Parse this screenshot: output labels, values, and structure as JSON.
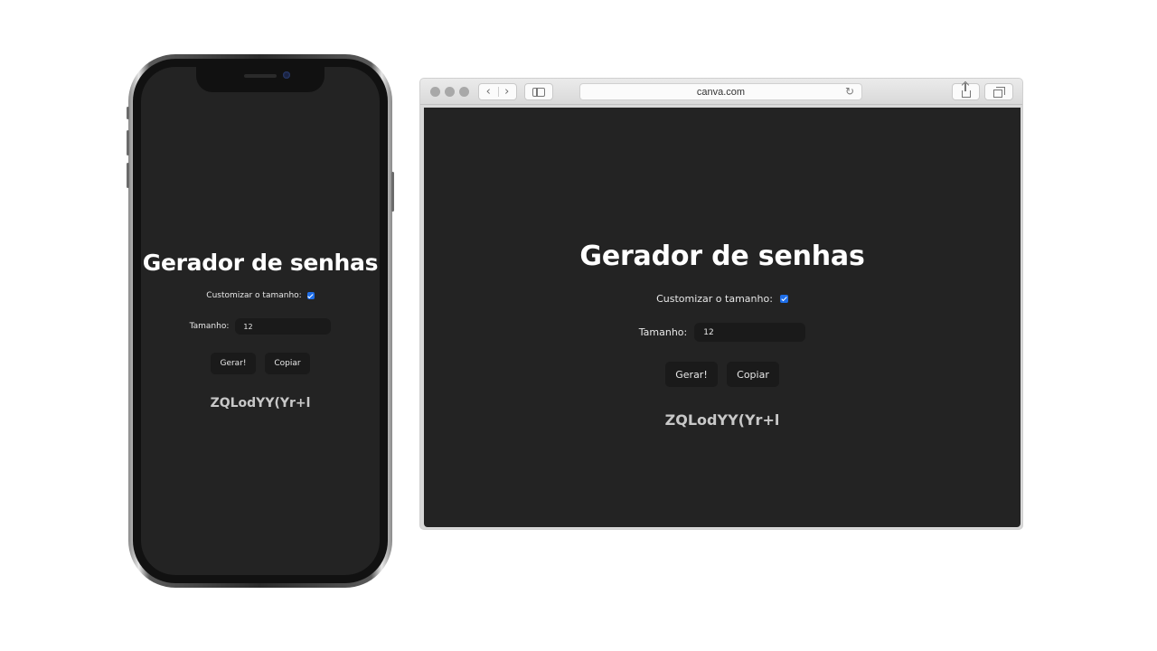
{
  "browser": {
    "address": "canva.com"
  },
  "app": {
    "title": "Gerador de senhas",
    "customize_label": "Customizar o tamanho:",
    "customize_checked": true,
    "size_label": "Tamanho:",
    "size_value": "12",
    "generate_button": "Gerar!",
    "copy_button": "Copiar",
    "password": "ZQLodYY(Yr+l"
  },
  "colors": {
    "app_background": "#232323",
    "checkbox_accent": "#1e6ee8",
    "button_background": "#1a1a1a"
  },
  "icons": [
    "back-icon",
    "forward-icon",
    "sidebar-icon",
    "reload-icon",
    "share-icon",
    "tabs-icon"
  ]
}
